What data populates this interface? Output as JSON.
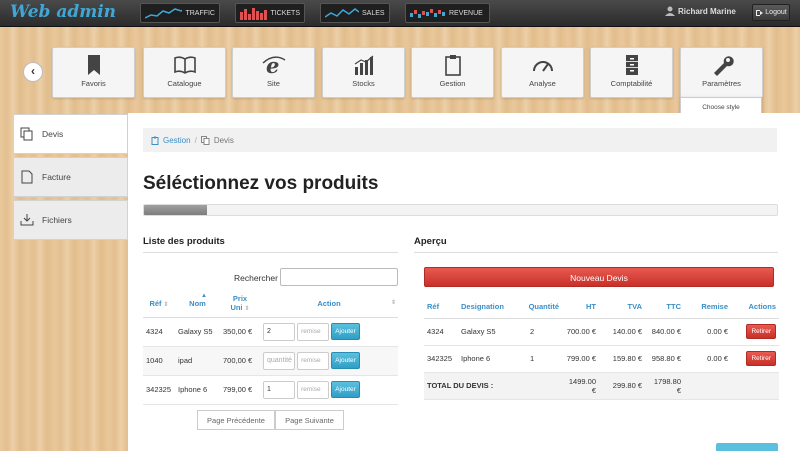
{
  "topbar": {
    "logo": "Web admin",
    "kpis": [
      {
        "label": "TRAFFIC",
        "icon": "line-chart-icon"
      },
      {
        "label": "TICKETS",
        "icon": "bar-chart-icon"
      },
      {
        "label": "SALES",
        "icon": "line-chart-icon"
      },
      {
        "label": "REVENUE",
        "icon": "bar-chart-icon"
      }
    ],
    "user_name": "Richard Marine",
    "logout_label": "Logout"
  },
  "nav": {
    "tiles": [
      {
        "label": "Favoris",
        "icon": "bookmark-icon"
      },
      {
        "label": "Catalogue",
        "icon": "book-icon"
      },
      {
        "label": "Site",
        "icon": "browser-icon"
      },
      {
        "label": "Stocks",
        "icon": "bar-chart-icon"
      },
      {
        "label": "Gestion",
        "icon": "clipboard-icon"
      },
      {
        "label": "Analyse",
        "icon": "gauge-icon"
      },
      {
        "label": "Comptabilité",
        "icon": "cabinet-icon"
      },
      {
        "label": "Paramètres",
        "icon": "wrench-icon"
      }
    ],
    "style_popup": {
      "title": "Choose style",
      "swatches": [
        "#3ab0d0",
        "#d9455a",
        "#3a8a5e"
      ]
    }
  },
  "sidebar": {
    "items": [
      {
        "label": "Devis",
        "active": true
      },
      {
        "label": "Facture",
        "active": false
      },
      {
        "label": "Fichiers",
        "active": false
      }
    ]
  },
  "breadcrumb": {
    "root": "Gestion",
    "sep": "/",
    "current": "Devis"
  },
  "page": {
    "title": "Séléctionnez vos produits",
    "progress": 0.1
  },
  "products": {
    "title": "Liste des produits",
    "search_label": "Rechercher",
    "columns": {
      "ref": "Réf",
      "nom": "Nom",
      "prix_line1": "Prix",
      "prix_line2": "Uni",
      "action": "Action"
    },
    "rows": [
      {
        "ref": "4324",
        "nom": "Galaxy S5",
        "prix": "350,00 €",
        "qty": "2",
        "remise": "remise",
        "add": "Ajouter"
      },
      {
        "ref": "1040",
        "nom": "ipad",
        "prix": "700,00 €",
        "qty": "quantité",
        "remise": "remise",
        "add": "Ajouter"
      },
      {
        "ref": "342325",
        "nom": "Iphone 6",
        "prix": "799,00 €",
        "qty": "1",
        "remise": "remise",
        "add": "Ajouter"
      }
    ],
    "pager": {
      "prev": "Page Précédente",
      "next": "Page Suivante"
    }
  },
  "apercu": {
    "title": "Aperçu",
    "new_button": "Nouveau Devis",
    "columns": [
      "Réf",
      "Designation",
      "Quantité",
      "HT",
      "TVA",
      "TTC",
      "Remise",
      "Actions"
    ],
    "rows": [
      {
        "ref": "4324",
        "designation": "Galaxy S5",
        "quantite": "2",
        "ht": "700.00 €",
        "tva": "140.00 €",
        "ttc": "840.00 €",
        "remise": "0.00 €",
        "action": "Retirer"
      },
      {
        "ref": "342325",
        "designation": "Iphone 6",
        "quantite": "1",
        "ht": "799.00 €",
        "tva": "159.80 €",
        "ttc": "958.80 €",
        "remise": "0.00 €",
        "action": "Retirer"
      }
    ],
    "total": {
      "label": "TOTAL DU DEVIS :",
      "ht": "1499.00 €",
      "tva": "299.80 €",
      "ttc": "1798.80 €"
    }
  }
}
